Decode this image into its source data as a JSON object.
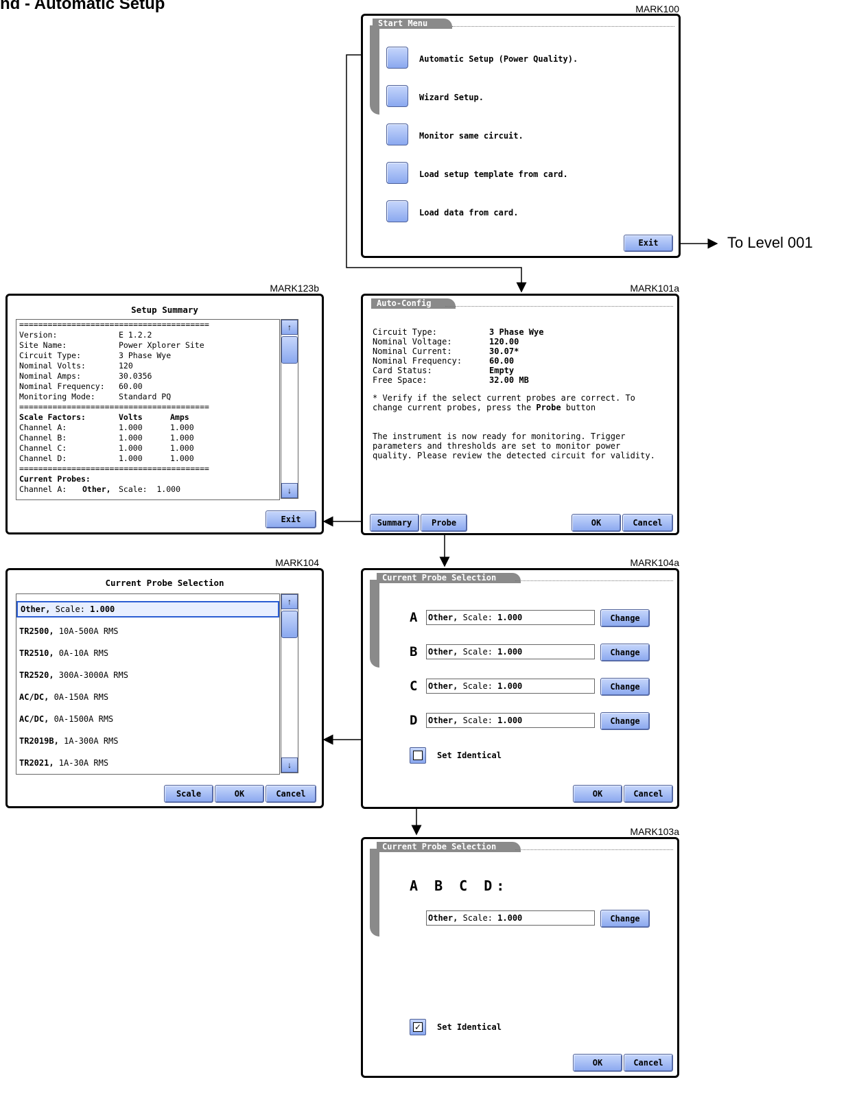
{
  "page_title": "nd - Automatic Setup",
  "marks": {
    "start": "MARK100",
    "autoconfig": "MARK101a",
    "summary": "MARK123b",
    "probe_list": "MARK104",
    "probe_sel": "MARK104a",
    "probe_identical": "MARK103a"
  },
  "to_level": "To Level 001",
  "start_menu": {
    "tab": "Start Menu",
    "options": [
      "Automatic Setup (Power Quality).",
      "Wizard Setup.",
      "Monitor same circuit.",
      "Load setup template from card.",
      "Load data from card."
    ],
    "exit": "Exit"
  },
  "auto_config": {
    "tab": "Auto-Config",
    "rows": [
      {
        "label": "Circuit Type:",
        "value": "3 Phase Wye"
      },
      {
        "label": "Nominal Voltage:",
        "value": "120.00"
      },
      {
        "label": "Nominal Current:",
        "value": "30.07*"
      },
      {
        "label": "Nominal Frequency:",
        "value": "60.00"
      },
      {
        "label": "Card Status:",
        "value": "Empty"
      },
      {
        "label": "Free Space:",
        "value": "32.00 MB"
      }
    ],
    "note_line1": "* Verify if the select current probes are correct. To",
    "note_line2_pre": "change current probes, press the ",
    "note_line2_bold": "Probe",
    "note_line2_post": " button",
    "ready_text": "The instrument is now ready for monitoring. Trigger\nparameters and thresholds are set to monitor power\nquality. Please review the detected circuit for validity.",
    "buttons": {
      "summary": "Summary",
      "probe": "Probe",
      "ok": "OK",
      "cancel": "Cancel"
    }
  },
  "summary": {
    "title": "Setup Summary",
    "sep": "========================================",
    "rows": [
      {
        "label": "Version:",
        "value": "E 1.2.2"
      },
      {
        "label": "Site Name:",
        "value": "Power Xplorer Site"
      },
      {
        "label": "Circuit Type:",
        "value": "3 Phase Wye"
      },
      {
        "label": "Nominal Volts:",
        "value": "120"
      },
      {
        "label": "Nominal Amps:",
        "value": "30.0356"
      },
      {
        "label": "Nominal Frequency:",
        "value": "60.00"
      },
      {
        "label": "Monitoring Mode:",
        "value": "Standard PQ"
      }
    ],
    "scale_header": {
      "label": "Scale Factors:",
      "volts": "Volts",
      "amps": "Amps"
    },
    "scale_rows": [
      {
        "label": "Channel A:",
        "volts": "1.000",
        "amps": "1.000"
      },
      {
        "label": "Channel B:",
        "volts": "1.000",
        "amps": "1.000"
      },
      {
        "label": "Channel C:",
        "volts": "1.000",
        "amps": "1.000"
      },
      {
        "label": "Channel D:",
        "volts": "1.000",
        "amps": "1.000"
      }
    ],
    "probes_header": "Current Probes:",
    "probe_row": {
      "label": "Channel A:",
      "name": "Other,",
      "scale": "Scale:  1.000"
    },
    "exit": "Exit"
  },
  "probe_list": {
    "title": "Current Probe Selection",
    "items": [
      {
        "name": "Other,",
        "desc": " Scale: ",
        "extra": "1.000"
      },
      {
        "name": "TR2500,",
        "desc": " 10A-500A RMS",
        "extra": ""
      },
      {
        "name": "TR2510,",
        "desc": " 0A-10A RMS",
        "extra": ""
      },
      {
        "name": "TR2520,",
        "desc": " 300A-3000A RMS",
        "extra": ""
      },
      {
        "name": "AC/DC,",
        "desc": " 0A-150A  RMS",
        "extra": ""
      },
      {
        "name": "AC/DC,",
        "desc": " 0A-1500A RMS",
        "extra": ""
      },
      {
        "name": "TR2019B,",
        "desc": " 1A-300A RMS",
        "extra": ""
      },
      {
        "name": "TR2021,",
        "desc": " 1A-30A RMS",
        "extra": ""
      }
    ],
    "buttons": {
      "scale": "Scale",
      "ok": "OK",
      "cancel": "Cancel"
    }
  },
  "probe_sel": {
    "tab": "Current Probe Selection",
    "channels": [
      {
        "letter": "A",
        "name": "Other,",
        "scale_label": " Scale: ",
        "scale": "1.000"
      },
      {
        "letter": "B",
        "name": "Other,",
        "scale_label": " Scale: ",
        "scale": "1.000"
      },
      {
        "letter": "C",
        "name": "Other,",
        "scale_label": " Scale: ",
        "scale": "1.000"
      },
      {
        "letter": "D",
        "name": "Other,",
        "scale_label": " Scale: ",
        "scale": "1.000"
      }
    ],
    "change": "Change",
    "set_identical": "Set Identical",
    "ok": "OK",
    "cancel": "Cancel"
  },
  "probe_identical": {
    "tab": "Current Probe Selection",
    "channels_label": "A B C D:",
    "field": {
      "name": "Other,",
      "scale_label": " Scale: ",
      "scale": "1.000"
    },
    "change": "Change",
    "set_identical": "Set Identical",
    "checked_mark": "✓",
    "ok": "OK",
    "cancel": "Cancel"
  }
}
